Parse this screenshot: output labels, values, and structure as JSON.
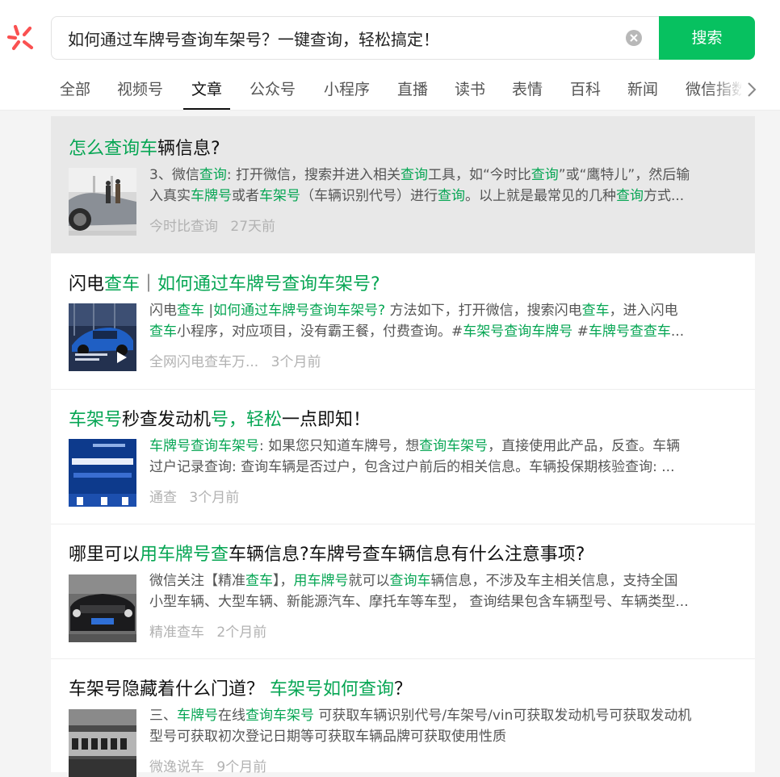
{
  "search": {
    "query": "如何通过车牌号查询车架号？一键查询，轻松搞定！",
    "button_label": "搜索"
  },
  "tabs": [
    {
      "label": "全部"
    },
    {
      "label": "视频号"
    },
    {
      "label": "文章"
    },
    {
      "label": "公众号"
    },
    {
      "label": "小程序"
    },
    {
      "label": "直播"
    },
    {
      "label": "读书"
    },
    {
      "label": "表情"
    },
    {
      "label": "百科"
    },
    {
      "label": "新闻"
    },
    {
      "label": "微信指数"
    }
  ],
  "active_tab": "文章",
  "colors": {
    "accent": "#07c160",
    "highlight": "#07a654",
    "logo": "#fa5151"
  },
  "results": [
    {
      "title_parts": [
        {
          "t": "怎么查询车",
          "h": true
        },
        {
          "t": "辆信息?",
          "h": false
        }
      ],
      "snippet_lines": [
        [
          {
            "t": "3、微信",
            "h": false
          },
          {
            "t": "查询",
            "h": true
          },
          {
            "t": ": 打开微信，搜索并进入相关",
            "h": false
          },
          {
            "t": "查询",
            "h": true
          },
          {
            "t": "工具，如“今时比",
            "h": false
          },
          {
            "t": "查询",
            "h": true
          },
          {
            "t": "”或“鹰特儿”，然后输",
            "h": false
          }
        ],
        [
          {
            "t": "入真实",
            "h": false
          },
          {
            "t": "车牌号",
            "h": true
          },
          {
            "t": "或者",
            "h": false
          },
          {
            "t": "车架号",
            "h": true
          },
          {
            "t": "（车辆识别代号）进行",
            "h": false
          },
          {
            "t": "查询",
            "h": true
          },
          {
            "t": "。以上就是最常见的几种",
            "h": false
          },
          {
            "t": "查询",
            "h": true
          },
          {
            "t": "方式...",
            "h": false
          }
        ]
      ],
      "source": "今时比查询",
      "time": "27天前",
      "thumb_icon": "car-showroom-thumbnail"
    },
    {
      "title_parts": [
        {
          "t": "闪电",
          "h": false
        },
        {
          "t": "查车",
          "h": true
        },
        {
          "t": "｜",
          "h": false
        },
        {
          "t": "如何通过车牌号查询车架号?",
          "h": true
        }
      ],
      "snippet_lines": [
        [
          {
            "t": "闪电",
            "h": false
          },
          {
            "t": "查车",
            "h": true
          },
          {
            "t": " |",
            "h": false
          },
          {
            "t": "如何通过车牌号查询车架号?",
            "h": true
          },
          {
            "t": " 方法如下，打开微信，搜索闪电",
            "h": false
          },
          {
            "t": "查车",
            "h": true
          },
          {
            "t": "，进入闪电",
            "h": false
          }
        ],
        [
          {
            "t": "查车",
            "h": true
          },
          {
            "t": "小程序，对应项目，没有霸王餐，付费查询。#",
            "h": false
          },
          {
            "t": "车架号查询车牌号",
            "h": true
          },
          {
            "t": " #",
            "h": false
          },
          {
            "t": "车牌号查查车",
            "h": true
          },
          {
            "t": "...",
            "h": false
          }
        ]
      ],
      "source": "全网闪电查车万...",
      "time": "3个月前",
      "thumb_icon": "blue-suv-video-thumbnail"
    },
    {
      "title_parts": [
        {
          "t": "车架号",
          "h": true
        },
        {
          "t": "秒查发动机",
          "h": false
        },
        {
          "t": "号，轻松",
          "h": true
        },
        {
          "t": "一点即知！",
          "h": false
        }
      ],
      "snippet_lines": [
        [
          {
            "t": "车牌号查询车架号",
            "h": true
          },
          {
            "t": ": 如果您只知道车牌号，想",
            "h": false
          },
          {
            "t": "查询车架号",
            "h": true
          },
          {
            "t": "，直接使用此产品，反查。车辆",
            "h": false
          }
        ],
        [
          {
            "t": "过户记录查询: 查询车辆是否过户，包含过户前后的相关信息。车辆投保期核验查询: ...",
            "h": false
          }
        ]
      ],
      "source": "通查",
      "time": "3个月前",
      "thumb_icon": "blue-poster-thumbnail"
    },
    {
      "title_parts": [
        {
          "t": "哪里可以",
          "h": false
        },
        {
          "t": "用车牌号查",
          "h": true
        },
        {
          "t": "车辆信息?车牌号查车辆信息有什么注意事项?",
          "h": false
        }
      ],
      "snippet_lines": [
        [
          {
            "t": "微信关注【精准",
            "h": false
          },
          {
            "t": "查车",
            "h": true
          },
          {
            "t": "】，",
            "h": false
          },
          {
            "t": "用车牌号",
            "h": true
          },
          {
            "t": "就可以",
            "h": false
          },
          {
            "t": "查询车",
            "h": true
          },
          {
            "t": "辆信息，不涉及车主相关信息，支持全国",
            "h": false
          }
        ],
        [
          {
            "t": "小型车辆、大型车辆、新能源汽车、摩托车等车型，  查询结果包含车辆型号、车辆类型...",
            "h": false
          }
        ]
      ],
      "source": "精准查车",
      "time": "2个月前",
      "thumb_icon": "black-car-thumbnail"
    },
    {
      "title_parts": [
        {
          "t": "车架号隐藏着什么门道？ ",
          "h": false
        },
        {
          "t": "车架号如何查询",
          "h": true
        },
        {
          "t": "？",
          "h": false
        }
      ],
      "snippet_lines": [
        [
          {
            "t": "三、",
            "h": false
          },
          {
            "t": "车牌号",
            "h": true
          },
          {
            "t": "在线",
            "h": false
          },
          {
            "t": "查询车架号",
            "h": true
          },
          {
            "t": " 可获取车辆识别代号/车架号/vin可获取发动机号可获取发动机",
            "h": false
          }
        ],
        [
          {
            "t": "型号可获取初次登记日期等可获取车辆品牌可获取使用性质",
            "h": false
          }
        ]
      ],
      "source": "微逸说车",
      "time": "9个月前",
      "thumb_icon": "vin-plate-thumbnail"
    }
  ]
}
